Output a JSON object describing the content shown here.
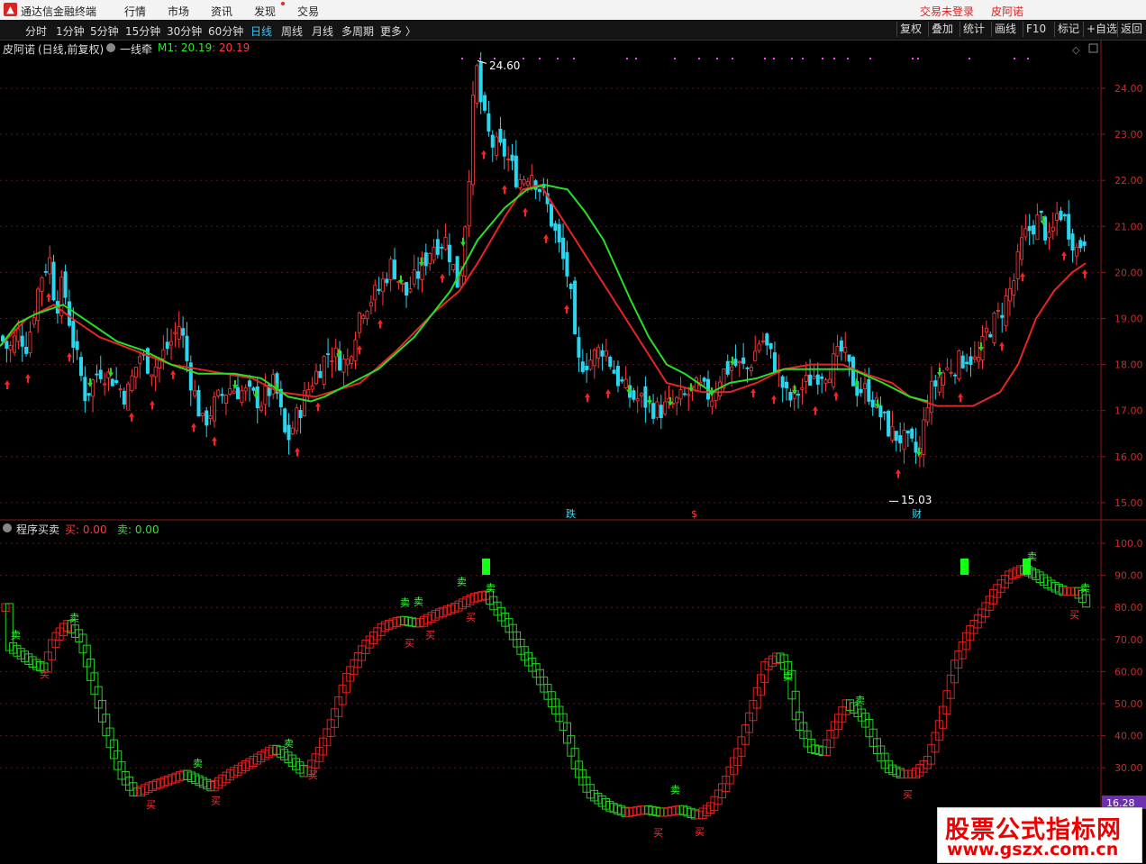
{
  "menubar": {
    "app_title": "通达信金融终端",
    "items": [
      "行情",
      "市场",
      "资讯",
      "发现",
      "交易"
    ],
    "login_status": "交易未登录",
    "stock_link": "皮阿诺"
  },
  "toolbar": {
    "periods": [
      "分时",
      "1分钟",
      "5分钟",
      "15分钟",
      "30分钟",
      "60分钟",
      "日线",
      "周线",
      "月线",
      "多周期",
      "更多 〉"
    ],
    "active_period": "日线",
    "right_buttons": [
      "复权",
      "叠加",
      "统计",
      "画线",
      "F10",
      "标记",
      "+自选",
      "返回"
    ]
  },
  "main_panel": {
    "stock_name": "皮阿诺",
    "mode": "(日线,前复权)",
    "indicator": "一线牵",
    "m1_label": "M1: 20.19",
    "m2_label": ": 20.19",
    "high_label": "24.60",
    "low_label": "15.03",
    "event_labels": [
      "跌",
      "$",
      "财"
    ]
  },
  "sub_panel": {
    "title": "程序买卖",
    "buy_label": "买: 0.00",
    "sell_label": "卖: 0.00",
    "current_value": "16.28",
    "buy_mark_text": "买",
    "sell_mark_text": "卖"
  },
  "watermark": {
    "line1": "股票公式指标网",
    "line2": "www.gszx.com.cn"
  },
  "chart_data": [
    {
      "type": "candlestick",
      "title": "皮阿诺 (日线,前复权)",
      "ylim": [
        14.6,
        24.9
      ],
      "y_ticks": [
        "24.00",
        "23.00",
        "22.00",
        "21.00",
        "20.00",
        "19.00",
        "18.00",
        "17.00",
        "16.00",
        "15.00"
      ],
      "price_path": [
        [
          0,
          18.6
        ],
        [
          10,
          18.3
        ],
        [
          20,
          18.7
        ],
        [
          30,
          18.4
        ],
        [
          45,
          19.9
        ],
        [
          55,
          20.3
        ],
        [
          62,
          19.2
        ],
        [
          70,
          19.8
        ],
        [
          80,
          18.6
        ],
        [
          95,
          17.3
        ],
        [
          110,
          17.9
        ],
        [
          125,
          17.7
        ],
        [
          140,
          17.3
        ],
        [
          155,
          18.2
        ],
        [
          170,
          17.9
        ],
        [
          190,
          18.5
        ],
        [
          200,
          18.9
        ],
        [
          210,
          17.8
        ],
        [
          225,
          16.7
        ],
        [
          240,
          17.2
        ],
        [
          255,
          17.5
        ],
        [
          270,
          17.4
        ],
        [
          290,
          17.2
        ],
        [
          305,
          17.6
        ],
        [
          318,
          16.3
        ],
        [
          330,
          16.9
        ],
        [
          345,
          17.6
        ],
        [
          365,
          18.3
        ],
        [
          385,
          18.0
        ],
        [
          400,
          19.2
        ],
        [
          420,
          19.6
        ],
        [
          435,
          20.2
        ],
        [
          450,
          19.5
        ],
        [
          465,
          20.0
        ],
        [
          480,
          20.6
        ],
        [
          495,
          20.7
        ],
        [
          510,
          19.6
        ],
        [
          520,
          22.0
        ],
        [
          528,
          24.6
        ],
        [
          535,
          23.5
        ],
        [
          545,
          22.8
        ],
        [
          560,
          22.6
        ],
        [
          575,
          22.0
        ],
        [
          590,
          22.2
        ],
        [
          605,
          21.6
        ],
        [
          620,
          20.6
        ],
        [
          632,
          19.8
        ],
        [
          640,
          18.0
        ],
        [
          655,
          18.1
        ],
        [
          670,
          18.4
        ],
        [
          685,
          17.7
        ],
        [
          700,
          17.3
        ],
        [
          715,
          17.2
        ],
        [
          730,
          17.0
        ],
        [
          745,
          17.1
        ],
        [
          760,
          17.3
        ],
        [
          775,
          17.5
        ],
        [
          790,
          17.3
        ],
        [
          800,
          17.8
        ],
        [
          815,
          18.0
        ],
        [
          830,
          17.9
        ],
        [
          845,
          18.6
        ],
        [
          860,
          18.0
        ],
        [
          875,
          17.2
        ],
        [
          890,
          17.5
        ],
        [
          905,
          17.8
        ],
        [
          920,
          17.9
        ],
        [
          935,
          18.3
        ],
        [
          950,
          17.5
        ],
        [
          965,
          17.4
        ],
        [
          980,
          16.8
        ],
        [
          990,
          16.5
        ],
        [
          1000,
          16.4
        ],
        [
          1012,
          16.2
        ],
        [
          1020,
          16.0
        ],
        [
          1030,
          17.3
        ],
        [
          1045,
          17.8
        ],
        [
          1060,
          18.0
        ],
        [
          1075,
          18.2
        ],
        [
          1085,
          18.0
        ],
        [
          1095,
          18.7
        ],
        [
          1110,
          19.1
        ],
        [
          1125,
          19.8
        ],
        [
          1135,
          20.7
        ],
        [
          1145,
          21.0
        ],
        [
          1155,
          21.2
        ],
        [
          1165,
          20.6
        ],
        [
          1175,
          21.4
        ],
        [
          1185,
          21.0
        ],
        [
          1195,
          20.5
        ],
        [
          1205,
          20.8
        ]
      ],
      "green_line": [
        [
          0,
          18.4
        ],
        [
          20,
          18.9
        ],
        [
          40,
          19.1
        ],
        [
          70,
          19.3
        ],
        [
          100,
          18.9
        ],
        [
          130,
          18.5
        ],
        [
          160,
          18.3
        ],
        [
          190,
          18.0
        ],
        [
          220,
          17.8
        ],
        [
          260,
          17.8
        ],
        [
          290,
          17.7
        ],
        [
          320,
          17.3
        ],
        [
          345,
          17.2
        ],
        [
          360,
          17.3
        ],
        [
          380,
          17.5
        ],
        [
          420,
          17.9
        ],
        [
          460,
          18.6
        ],
        [
          500,
          19.6
        ],
        [
          530,
          20.7
        ],
        [
          560,
          21.4
        ],
        [
          585,
          21.8
        ],
        [
          605,
          21.9
        ],
        [
          630,
          21.8
        ],
        [
          650,
          21.3
        ],
        [
          670,
          20.7
        ],
        [
          700,
          19.4
        ],
        [
          720,
          18.6
        ],
        [
          740,
          18.0
        ],
        [
          760,
          17.8
        ],
        [
          790,
          17.4
        ],
        [
          810,
          17.6
        ],
        [
          840,
          17.7
        ],
        [
          870,
          17.9
        ],
        [
          910,
          17.9
        ],
        [
          945,
          17.9
        ],
        [
          980,
          17.6
        ],
        [
          1010,
          17.3
        ],
        [
          1030,
          17.2
        ]
      ],
      "red_line": [
        [
          0,
          18.4
        ],
        [
          30,
          19.0
        ],
        [
          60,
          19.3
        ],
        [
          80,
          19.0
        ],
        [
          110,
          18.6
        ],
        [
          150,
          18.3
        ],
        [
          190,
          18.0
        ],
        [
          220,
          17.9
        ],
        [
          280,
          17.7
        ],
        [
          310,
          17.4
        ],
        [
          350,
          17.3
        ],
        [
          400,
          17.6
        ],
        [
          440,
          18.3
        ],
        [
          480,
          19.1
        ],
        [
          510,
          19.6
        ],
        [
          530,
          20.2
        ],
        [
          560,
          21.2
        ],
        [
          580,
          21.8
        ],
        [
          600,
          21.9
        ],
        [
          740,
          17.6
        ],
        [
          780,
          17.4
        ],
        [
          810,
          17.4
        ],
        [
          840,
          17.6
        ],
        [
          870,
          17.9
        ],
        [
          900,
          18.0
        ],
        [
          935,
          18.0
        ],
        [
          960,
          17.8
        ],
        [
          990,
          17.6
        ],
        [
          1010,
          17.3
        ],
        [
          1040,
          17.1
        ],
        [
          1080,
          17.1
        ],
        [
          1110,
          17.4
        ],
        [
          1130,
          18.0
        ],
        [
          1150,
          19.0
        ],
        [
          1170,
          19.6
        ],
        [
          1190,
          20.0
        ],
        [
          1205,
          20.2
        ]
      ]
    },
    {
      "type": "line",
      "title": "程序买卖",
      "ylim": [
        18,
        106
      ],
      "y_ticks": [
        "100.0",
        "90.00",
        "80.00",
        "70.00",
        "60.00",
        "50.00",
        "40.00",
        "30.00"
      ],
      "series": [
        {
          "values": [
            [
              5,
              68
            ],
            [
              20,
              65
            ],
            [
              35,
              62
            ],
            [
              45,
              61
            ],
            [
              55,
              70
            ],
            [
              70,
              75
            ],
            [
              85,
              70
            ],
            [
              100,
              55
            ],
            [
              115,
              40
            ],
            [
              130,
              28
            ],
            [
              145,
              22
            ],
            [
              160,
              24
            ],
            [
              180,
              26
            ],
            [
              200,
              28
            ],
            [
              215,
              26
            ],
            [
              230,
              24
            ],
            [
              250,
              28
            ],
            [
              275,
              32
            ],
            [
              300,
              36
            ],
            [
              315,
              33
            ],
            [
              335,
              28
            ],
            [
              350,
              35
            ],
            [
              365,
              45
            ],
            [
              380,
              58
            ],
            [
              400,
              68
            ],
            [
              420,
              74
            ],
            [
              440,
              76
            ],
            [
              460,
              75
            ],
            [
              480,
              78
            ],
            [
              500,
              80
            ],
            [
              520,
              83
            ],
            [
              535,
              84
            ],
            [
              545,
              80
            ],
            [
              560,
              74
            ],
            [
              575,
              66
            ],
            [
              590,
              60
            ],
            [
              605,
              52
            ],
            [
              620,
              44
            ],
            [
              635,
              30
            ],
            [
              650,
              22
            ],
            [
              670,
              18
            ],
            [
              690,
              16
            ],
            [
              710,
              17
            ],
            [
              730,
              16
            ],
            [
              750,
              17
            ],
            [
              770,
              15
            ],
            [
              785,
              18
            ],
            [
              800,
              25
            ],
            [
              815,
              35
            ],
            [
              830,
              48
            ],
            [
              845,
              62
            ],
            [
              860,
              65
            ],
            [
              870,
              60
            ],
            [
              880,
              45
            ],
            [
              895,
              36
            ],
            [
              910,
              35
            ],
            [
              920,
              42
            ],
            [
              935,
              50
            ],
            [
              945,
              48
            ],
            [
              955,
              45
            ],
            [
              965,
              38
            ],
            [
              980,
              30
            ],
            [
              995,
              28
            ],
            [
              1010,
              28
            ],
            [
              1025,
              32
            ],
            [
              1040,
              45
            ],
            [
              1055,
              62
            ],
            [
              1070,
              72
            ],
            [
              1085,
              78
            ],
            [
              1100,
              85
            ],
            [
              1115,
              90
            ],
            [
              1130,
              92
            ],
            [
              1145,
              90
            ],
            [
              1160,
              87
            ],
            [
              1175,
              85
            ],
            [
              1190,
              85
            ],
            [
              1200,
              82
            ],
            [
              1205,
              80
            ]
          ]
        }
      ],
      "buy_markers_x": [
        50,
        168,
        240,
        348,
        455,
        478,
        523,
        731,
        777,
        1008,
        1193
      ],
      "sell_markers_x": [
        18,
        83,
        220,
        321,
        450,
        465,
        513,
        545,
        750,
        875,
        955,
        1146,
        1205
      ]
    }
  ]
}
